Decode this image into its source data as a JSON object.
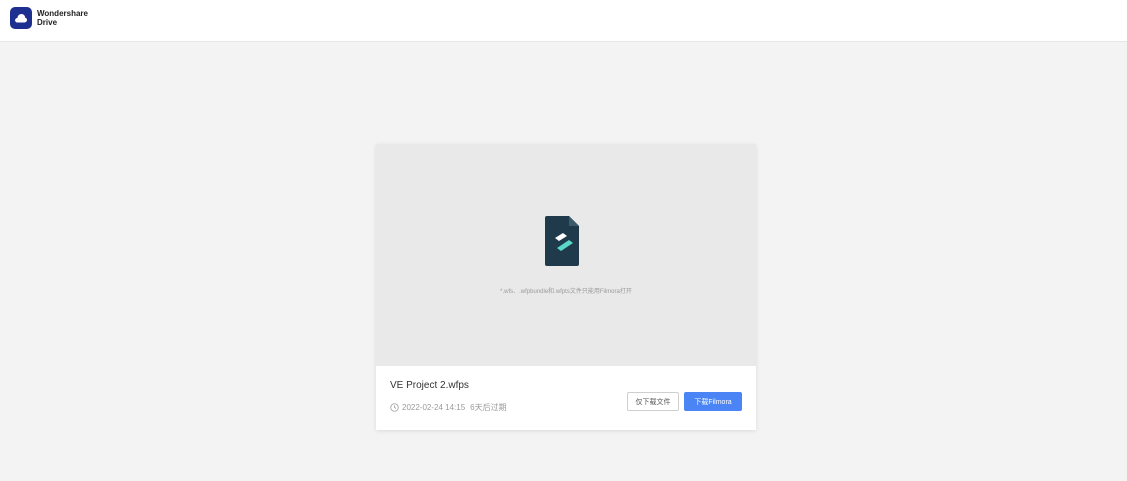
{
  "header": {
    "brand_line1": "Wondershare",
    "brand_line2": "Drive",
    "logo_icon": "cloud-icon"
  },
  "file": {
    "name": "VE Project 2.wfps",
    "date": "2022-02-24 14:15",
    "expiry": "6天后过期",
    "hint": "*.wfs、.wfpbundle和.wfpts文件只能用Filmora打开",
    "file_icon": "filmora-file-icon",
    "date_icon": "clock-icon"
  },
  "actions": {
    "download_only": "仅下载文件",
    "download_filmora": "下载Filmora"
  },
  "colors": {
    "accent": "#4a84f5",
    "logo": "#1d2f8f",
    "file_icon_dark": "#1f3a4a",
    "file_icon_accent": "#5ad8c8"
  }
}
